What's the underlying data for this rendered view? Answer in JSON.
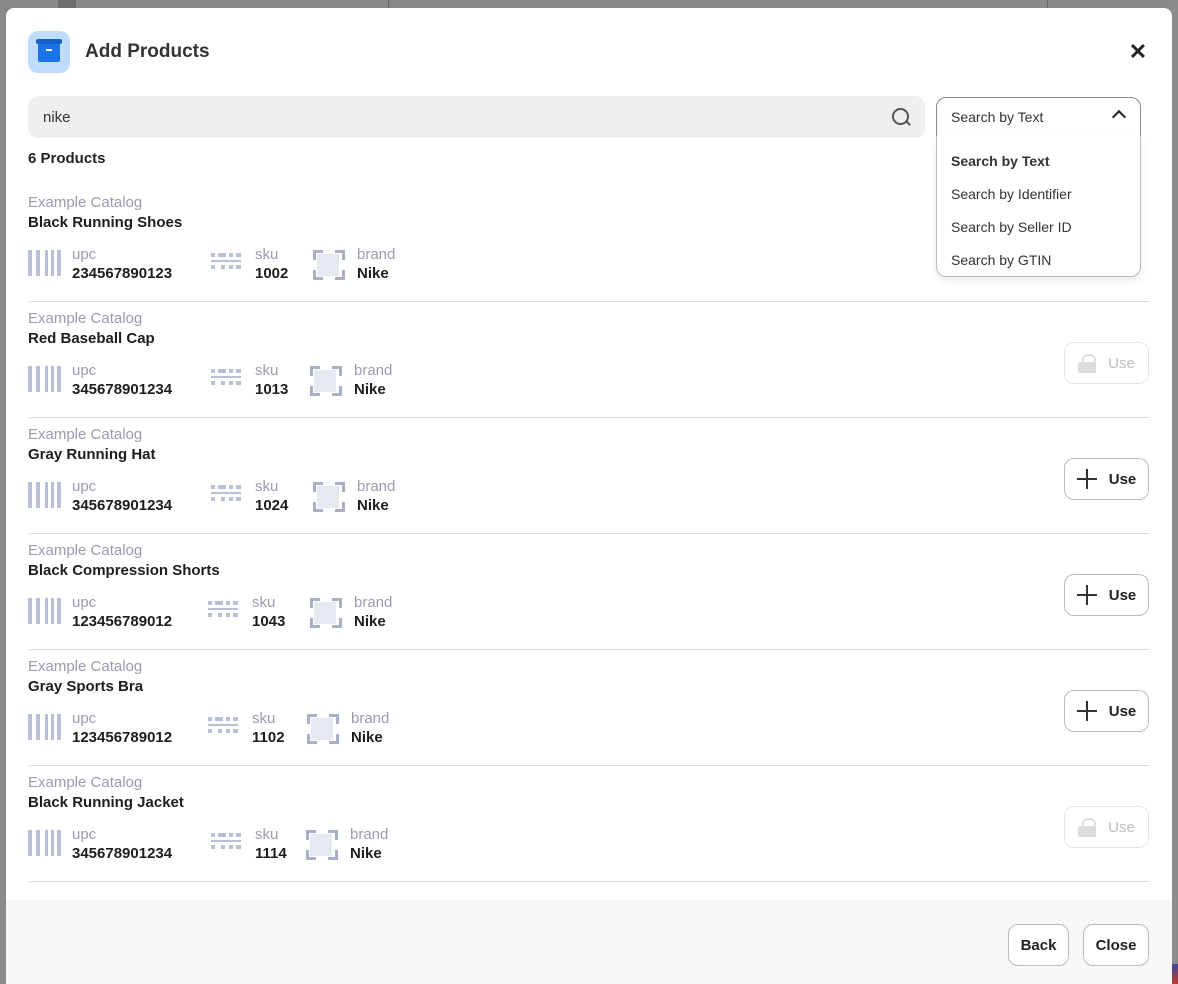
{
  "modal": {
    "title": "Add Products",
    "icon": "archive-box-icon"
  },
  "search": {
    "value": "nike",
    "mode_selected": "Search by Text",
    "mode_options": [
      "Search by Text",
      "Search by Identifier",
      "Search by Seller ID",
      "Search by GTIN"
    ]
  },
  "results": {
    "count_label": "6 Products",
    "attr_labels": {
      "upc": "upc",
      "sku": "sku",
      "brand": "brand"
    },
    "use_label": "Use",
    "items": [
      {
        "catalog": "Example Catalog",
        "name": "Black Running Shoes",
        "upc": "234567890123",
        "sku": "1002",
        "brand": "Nike",
        "state": "hidden"
      },
      {
        "catalog": "Example Catalog",
        "name": "Red Baseball Cap",
        "upc": "345678901234",
        "sku": "1013",
        "brand": "Nike",
        "state": "locked"
      },
      {
        "catalog": "Example Catalog",
        "name": "Gray Running Hat",
        "upc": "345678901234",
        "sku": "1024",
        "brand": "Nike",
        "state": "available"
      },
      {
        "catalog": "Example Catalog",
        "name": "Black Compression Shorts",
        "upc": "123456789012",
        "sku": "1043",
        "brand": "Nike",
        "state": "available"
      },
      {
        "catalog": "Example Catalog",
        "name": "Gray Sports Bra",
        "upc": "123456789012",
        "sku": "1102",
        "brand": "Nike",
        "state": "available"
      },
      {
        "catalog": "Example Catalog",
        "name": "Black Running Jacket",
        "upc": "345678901234",
        "sku": "1114",
        "brand": "Nike",
        "state": "locked"
      }
    ]
  },
  "footer": {
    "back_label": "Back",
    "close_label": "Close"
  },
  "colors": {
    "accent": "#1a73e8",
    "muted_text": "#9a9ab0",
    "search_bg": "#efefef"
  }
}
